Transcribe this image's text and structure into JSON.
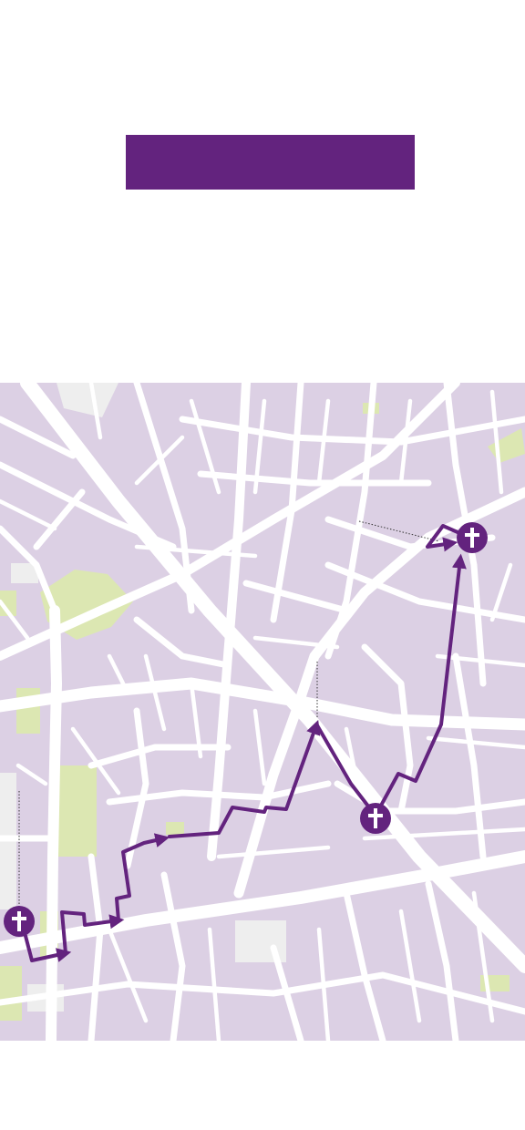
{
  "banner": {
    "text": "",
    "color": "#63237e"
  },
  "map": {
    "block_color": "#dcd0e4",
    "street_color": "#ffffff",
    "park_color": "#dce7b2",
    "plaza_color": "#eeeeee",
    "route_color": "#63237e",
    "markers": [
      {
        "name": "church-marker-west",
        "icon": "latin-cross-icon"
      },
      {
        "name": "church-marker-center",
        "icon": "latin-cross-icon"
      },
      {
        "name": "church-marker-northeast",
        "icon": "latin-cross-icon"
      }
    ]
  }
}
